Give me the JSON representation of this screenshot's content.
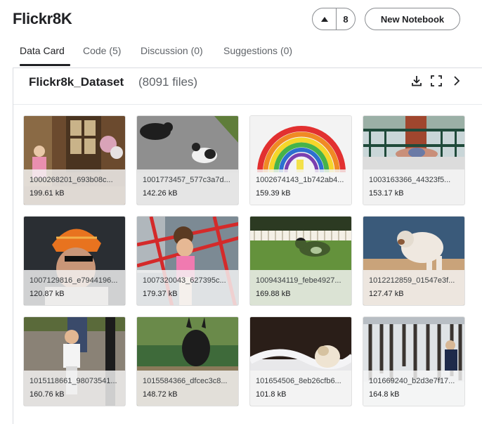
{
  "header": {
    "title": "Flickr8K",
    "vote_count": "8",
    "new_notebook_label": "New Notebook"
  },
  "tabs": [
    {
      "label": "Data Card",
      "active": true
    },
    {
      "label": "Code (5)",
      "active": false
    },
    {
      "label": "Discussion (0)",
      "active": false
    },
    {
      "label": "Suggestions (0)",
      "active": false
    }
  ],
  "dataset": {
    "name": "Flickr8k_Dataset",
    "file_count": "(8091 files)",
    "icons": [
      "download-icon",
      "fullscreen-icon",
      "chevron-right-icon"
    ]
  },
  "files": [
    {
      "name": "1000268201_693b08c...",
      "size": "199.61 kB"
    },
    {
      "name": "1001773457_577c3a7d...",
      "size": "142.26 kB"
    },
    {
      "name": "1002674143_1b742ab4...",
      "size": "159.39 kB"
    },
    {
      "name": "1003163366_44323f5...",
      "size": "153.17 kB"
    },
    {
      "name": "1007129816_e7944196...",
      "size": "120.87 kB"
    },
    {
      "name": "1007320043_627395c...",
      "size": "179.37 kB"
    },
    {
      "name": "1009434119_febe4927...",
      "size": "169.88 kB"
    },
    {
      "name": "1012212859_01547e3f...",
      "size": "127.47 kB"
    },
    {
      "name": "1015118661_98073541...",
      "size": "160.76 kB"
    },
    {
      "name": "1015584366_dfcec3c8...",
      "size": "148.72 kB"
    },
    {
      "name": "101654506_8eb26cfb6...",
      "size": "101.8 kB"
    },
    {
      "name": "101669240_b2d3e7f17...",
      "size": "164.8 kB"
    }
  ]
}
